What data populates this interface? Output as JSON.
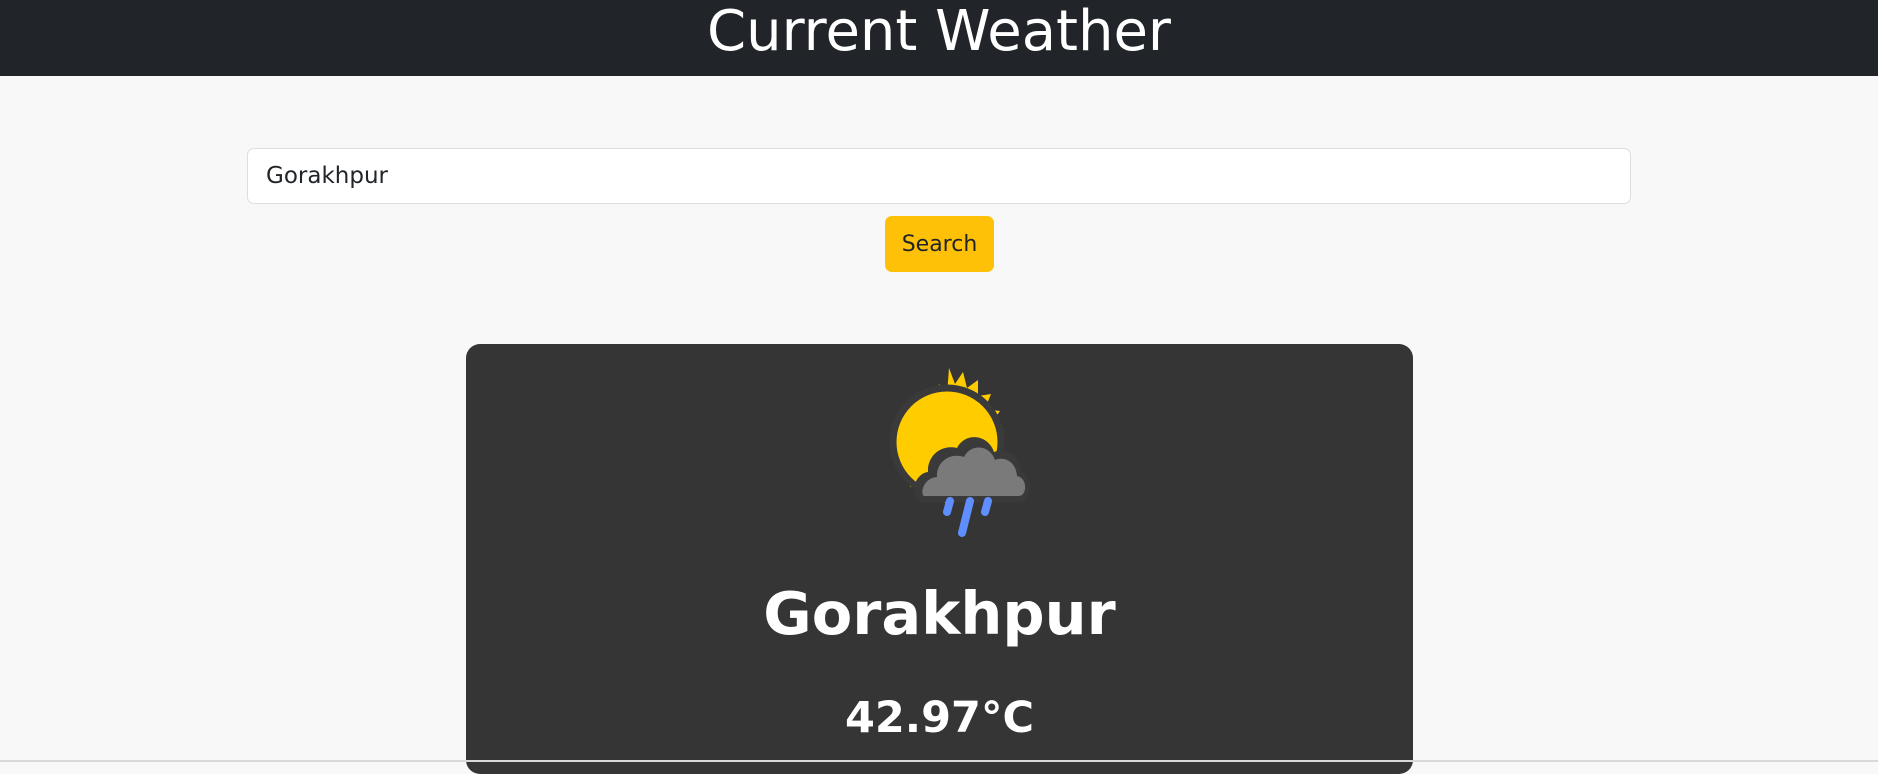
{
  "header": {
    "title": "Current Weather"
  },
  "search": {
    "value": "Gorakhpur",
    "button_label": "Search"
  },
  "weather": {
    "icon": "sun-cloud-rain-icon",
    "city": "Gorakhpur",
    "temperature": "42.97°C"
  },
  "colors": {
    "header_bg": "#212529",
    "page_bg": "#f8f8f8",
    "button_bg": "#ffc107",
    "card_bg": "#353535",
    "sun": "#ffcc00",
    "cloud": "#7a7a7a",
    "rain": "#5f8fff"
  }
}
